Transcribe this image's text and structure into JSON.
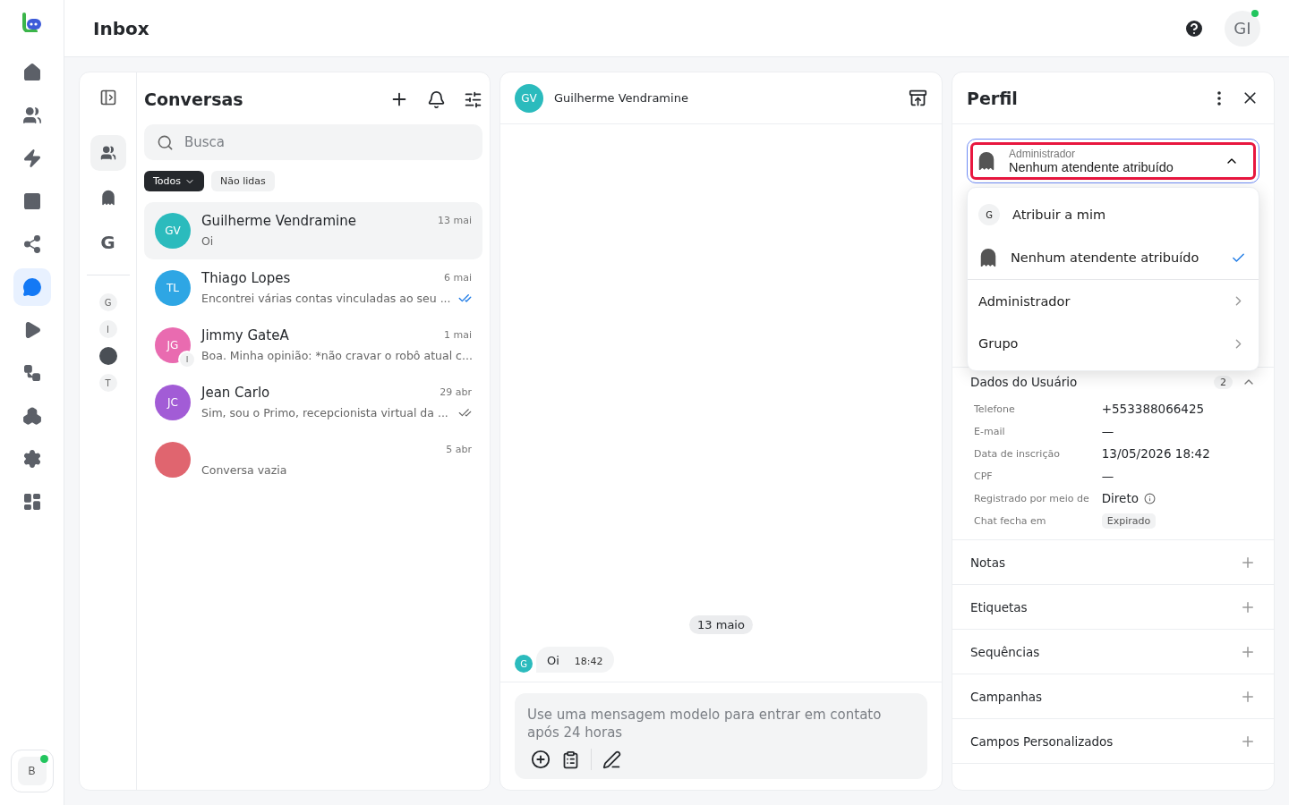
{
  "header": {
    "title": "Inbox",
    "user_initials": "GI",
    "online": true
  },
  "nav": [
    {
      "selected": false
    },
    {
      "selected": false
    },
    {
      "selected": false
    },
    {
      "selected": false
    },
    {
      "selected": false
    },
    {
      "selected": true
    },
    {
      "selected": false
    },
    {
      "selected": false
    },
    {
      "selected": false
    },
    {
      "selected": false
    },
    {
      "selected": false
    }
  ],
  "workspace": {
    "initial": "B",
    "online": true
  },
  "conversations": {
    "title": "Conversas",
    "search": {
      "placeholder": "Busca"
    },
    "inboxes": [
      {
        "kind": "team",
        "selected": true
      },
      {
        "kind": "ghost",
        "selected": false
      },
      {
        "kind": "letter",
        "label": "G",
        "selected": false
      }
    ],
    "agents": [
      {
        "kind": "letter",
        "label": "G"
      },
      {
        "kind": "letter",
        "label": "I"
      },
      {
        "kind": "photo"
      },
      {
        "kind": "letter",
        "label": "T"
      }
    ],
    "filters": [
      {
        "label": "Todos",
        "selected": true,
        "has_menu": true
      },
      {
        "label": "Não lidas",
        "selected": false,
        "has_menu": false
      }
    ],
    "items": [
      {
        "initials": "GV",
        "name": "Guilherme Vendramine",
        "date": "13 mai",
        "preview": "Oi",
        "selected": true,
        "color": "#2bbbbd"
      },
      {
        "initials": "TL",
        "name": "Thiago Lopes",
        "date": "6 mai",
        "preview": "Encontrei várias contas vinculadas ao seu ...",
        "selected": false,
        "color": "#2ea6e4",
        "read": true
      },
      {
        "initials": "JG",
        "name": "Jimmy GateA",
        "date": "1 mai",
        "preview": "Boa. Minha opinião: *não cravar o robô atual c...",
        "selected": false,
        "color": "#e96bb0",
        "agent": "I"
      },
      {
        "initials": "JC",
        "name": "Jean Carlo",
        "date": "29 abr",
        "preview": "Sim, sou o Primo, recepcionista virtual da ...",
        "selected": false,
        "color": "#a25cd6",
        "read": false
      },
      {
        "date": "5 abr",
        "preview": "Conversa vazia",
        "selected": false,
        "color": "#e0656f"
      }
    ]
  },
  "chat": {
    "contact": {
      "initials": "GV",
      "name": "Guilherme Vendramine"
    },
    "date_divider": "13 maio",
    "messages": [
      {
        "sender": "G",
        "text": "Oi",
        "time": "18:42"
      }
    ],
    "composer": {
      "placeholder": "Use uma mensagem modelo para entrar em contato após 24 horas"
    }
  },
  "profile": {
    "title": "Perfil",
    "assignee": {
      "label": "Administrador",
      "value": "Nenhum atendente atribuído",
      "open": true
    },
    "menu": [
      {
        "kind": "user",
        "initial": "G",
        "label": "Atribuir a mim",
        "selected": false
      },
      {
        "kind": "ghost",
        "label": "Nenhum atendente atribuído",
        "selected": true
      },
      {
        "kind": "submenu",
        "label": "Administrador",
        "selected": false
      },
      {
        "kind": "submenu",
        "label": "Grupo",
        "selected": false
      }
    ],
    "user_data": {
      "title": "Dados do Usuário",
      "count": "2",
      "fields": [
        {
          "label": "Telefone",
          "value": "+553388066425",
          "kind": "text"
        },
        {
          "label": "E-mail",
          "value": "—",
          "kind": "text"
        },
        {
          "label": "Data de inscrição",
          "value": "13/05/2026 18:42",
          "kind": "text"
        },
        {
          "label": "CPF",
          "value": "—",
          "kind": "text"
        },
        {
          "label": "Registrado por meio de",
          "value": "Direto",
          "kind": "info"
        },
        {
          "label": "Chat fecha em",
          "value": "Expirado",
          "kind": "tag"
        }
      ]
    },
    "sections": [
      "Notas",
      "Etiquetas",
      "Sequências",
      "Campanhas",
      "Campos Personalizados"
    ]
  }
}
